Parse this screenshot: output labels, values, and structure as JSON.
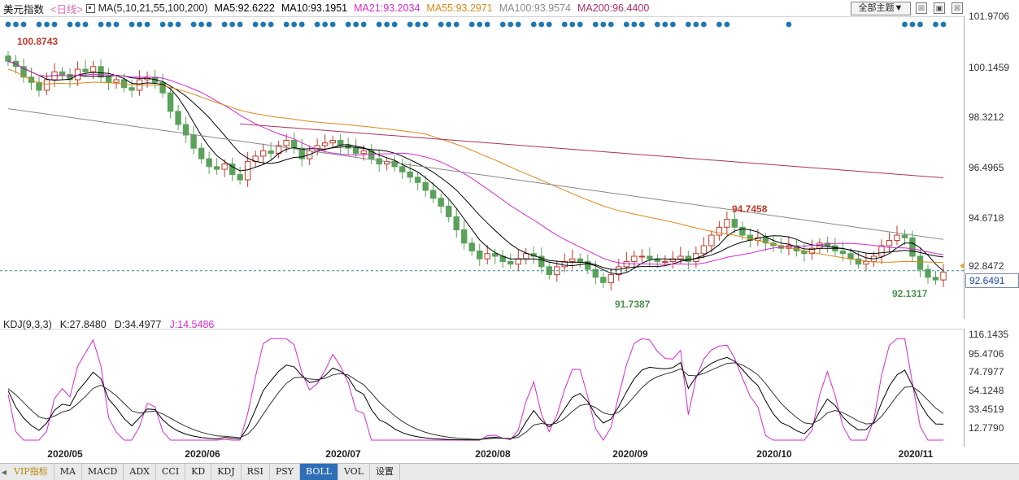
{
  "header": {
    "title": "美元指数",
    "period": "<日线>",
    "ma_params": "MA(5,10,21,55,100,200)",
    "indicators": [
      {
        "label": "MA5:92.6222",
        "color": "#000000"
      },
      {
        "label": "MA10:93.1951",
        "color": "#000000"
      },
      {
        "label": "MA21:93.2034",
        "color": "#d62ad0"
      },
      {
        "label": "MA55:93.2971",
        "color": "#d98a1a"
      },
      {
        "label": "MA100:93.9574",
        "color": "#8a8a8a"
      },
      {
        "label": "MA200:96.4400",
        "color": "#b03060"
      }
    ],
    "theme_dropdown": "全部主题▼",
    "window_buttons": [
      "☒",
      "▣",
      "☒"
    ]
  },
  "price_axis": {
    "labels": [
      "101.9706",
      "100.1459",
      "98.3212",
      "96.4965",
      "94.6718",
      "92.8472"
    ],
    "last_price": "92.6491"
  },
  "kdj": {
    "header": [
      {
        "label": "KDJ(9,3,3)",
        "color": "#222222"
      },
      {
        "label": "K:27.8480",
        "color": "#222222"
      },
      {
        "label": "D:34.4977",
        "color": "#222222"
      },
      {
        "label": "J:14.5486",
        "color": "#d62ad0"
      }
    ],
    "axis_labels": [
      "116.1435",
      "95.4706",
      "74.7977",
      "54.1248",
      "33.4519",
      "12.7790"
    ]
  },
  "annotations": {
    "high_1": "100.8743",
    "high_2": "94.7458",
    "low_1": "91.7387",
    "low_2": "92.1317"
  },
  "x_axis": {
    "labels": [
      "2020/05",
      "2020/06",
      "2020/07",
      "2020/08",
      "2020/09",
      "2020/10",
      "2020/11"
    ]
  },
  "tabs": [
    "VIP指标",
    "MA",
    "MACD",
    "ADX",
    "CCI",
    "KD",
    "KDJ",
    "RSI",
    "PSY",
    "BOLL",
    "VOL",
    "设置"
  ],
  "active_tab": "BOLL",
  "colors": {
    "up": "#c0392b",
    "down": "#5aa25a",
    "ma5": "#000000",
    "ma10": "#000000",
    "ma21": "#d62ad0",
    "ma55": "#d98a1a",
    "ma100": "#8a8a8a",
    "ma200": "#b03060",
    "dots": "#1f77b4"
  },
  "chart_data": {
    "type": "candlestick",
    "title": "美元指数",
    "ylim": [
      91.5,
      102.0
    ],
    "close_series": [
      100.6,
      100.4,
      100.0,
      99.8,
      99.5,
      99.9,
      100.2,
      100.1,
      99.9,
      100.3,
      100.2,
      100.4,
      100.0,
      99.8,
      99.9,
      99.6,
      99.5,
      99.9,
      100.0,
      99.8,
      99.4,
      98.7,
      98.2,
      97.8,
      97.3,
      96.9,
      96.6,
      96.5,
      96.7,
      96.3,
      96.1,
      96.8,
      97.0,
      97.2,
      97.1,
      97.4,
      97.6,
      97.3,
      96.9,
      97.2,
      97.4,
      97.5,
      97.6,
      97.4,
      97.3,
      97.1,
      97.2,
      96.9,
      96.7,
      96.8,
      96.6,
      96.4,
      96.2,
      96.0,
      95.7,
      95.4,
      95.1,
      94.7,
      94.2,
      93.7,
      93.4,
      93.1,
      93.3,
      93.2,
      93.0,
      92.9,
      93.1,
      93.3,
      93.2,
      92.8,
      92.5,
      92.8,
      93.0,
      93.1,
      93.0,
      92.7,
      92.4,
      92.2,
      92.5,
      92.8,
      93.0,
      93.2,
      93.2,
      93.1,
      93.0,
      93.0,
      93.1,
      93.2,
      93.0,
      93.3,
      93.6,
      94.0,
      94.3,
      94.6,
      94.3,
      94.0,
      93.8,
      93.9,
      93.7,
      93.6,
      93.5,
      93.6,
      93.4,
      93.3,
      93.5,
      93.7,
      93.6,
      93.4,
      93.3,
      93.1,
      92.9,
      93.0,
      93.2,
      93.6,
      93.8,
      94.0,
      93.9,
      93.2,
      92.7,
      92.4,
      92.3,
      92.6
    ],
    "annotations": [
      {
        "label": "100.8743",
        "type": "high"
      },
      {
        "label": "94.7458",
        "type": "high"
      },
      {
        "label": "91.7387",
        "type": "low"
      },
      {
        "label": "92.1317",
        "type": "low"
      }
    ],
    "kdj_ylim": [
      0,
      120
    ]
  }
}
